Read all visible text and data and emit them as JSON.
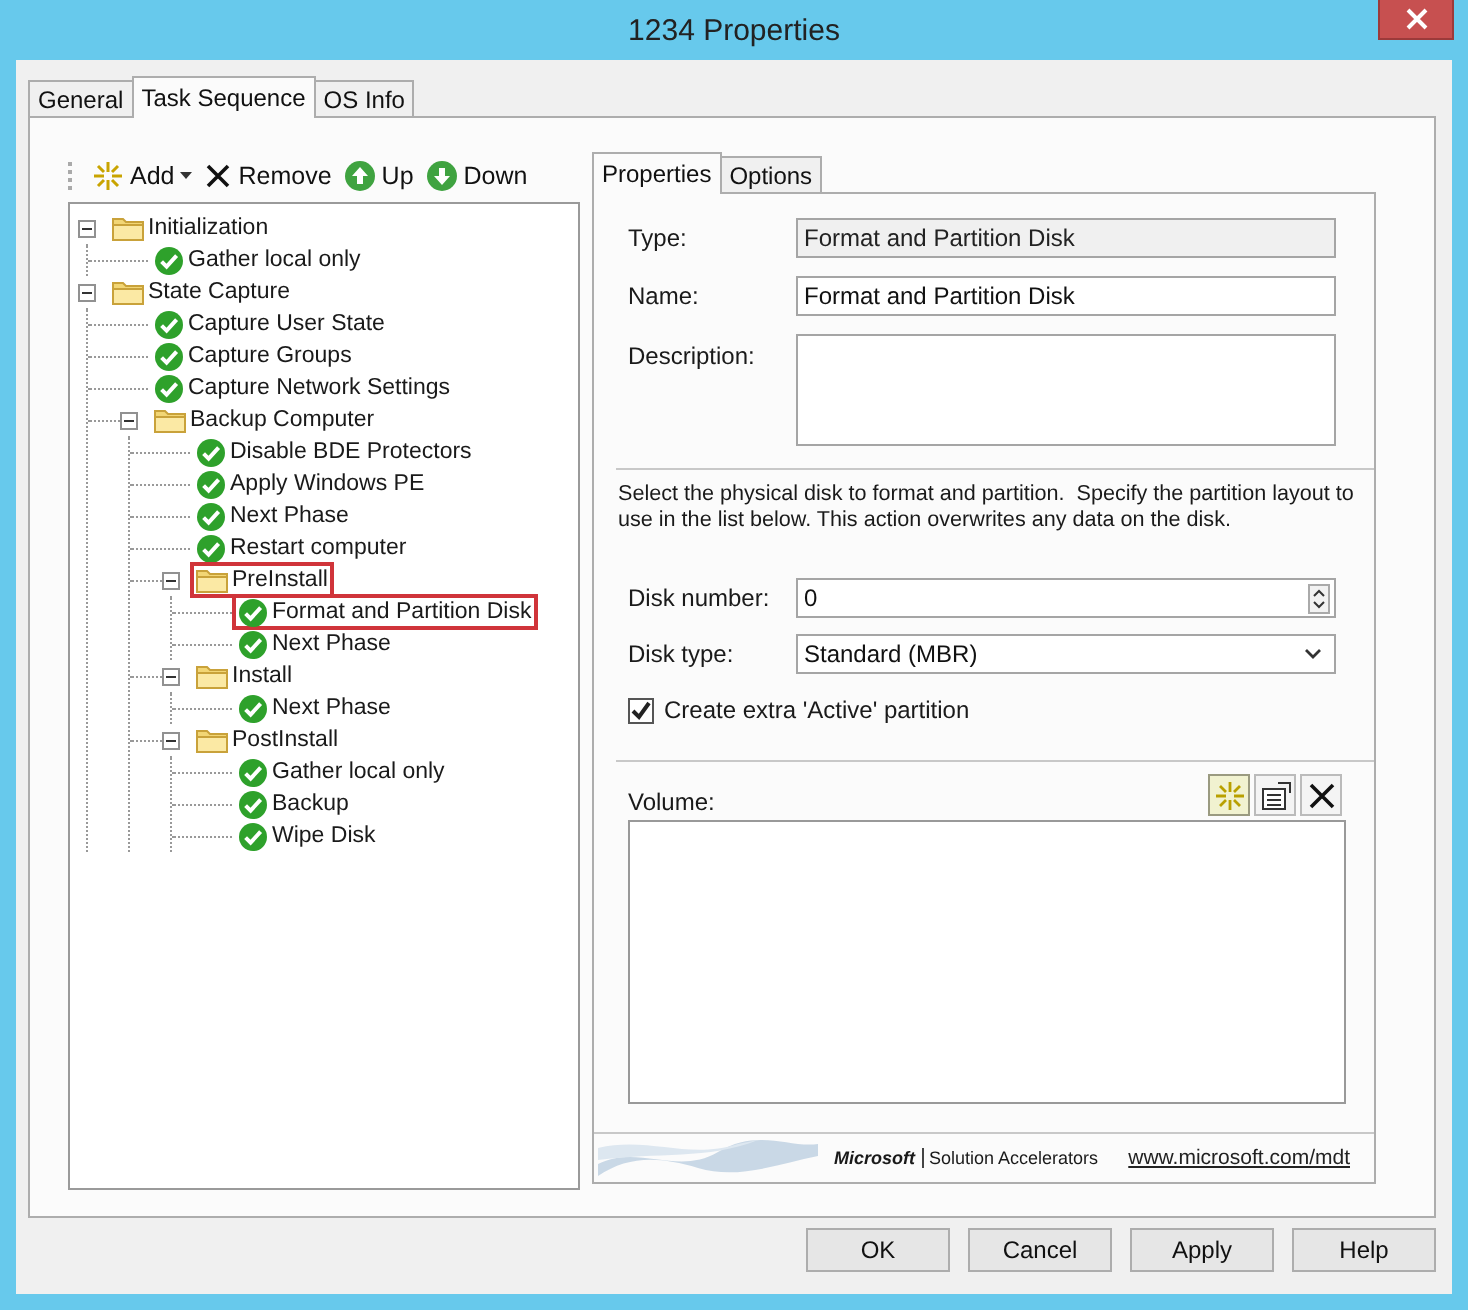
{
  "window": {
    "title": "1234 Properties"
  },
  "tabs": [
    {
      "label": "General",
      "selected": false
    },
    {
      "label": "Task Sequence",
      "selected": true
    },
    {
      "label": "OS Info",
      "selected": false
    }
  ],
  "toolbar": [
    {
      "label": "Add",
      "kind": "add",
      "dropdown": true
    },
    {
      "label": "Remove",
      "kind": "remove",
      "dropdown": false
    },
    {
      "label": "Up",
      "kind": "up",
      "dropdown": false
    },
    {
      "label": "Down",
      "kind": "down",
      "dropdown": false
    }
  ],
  "tree": [
    {
      "label": "Initialization",
      "kind": "group",
      "expanded": true,
      "highlighted": false,
      "children": [
        {
          "label": "Gather local only",
          "kind": "step",
          "highlighted": false
        }
      ]
    },
    {
      "label": "State Capture",
      "kind": "group",
      "expanded": true,
      "highlighted": false,
      "children": [
        {
          "label": "Capture User State",
          "kind": "step",
          "highlighted": false
        },
        {
          "label": "Capture Groups",
          "kind": "step",
          "highlighted": false
        },
        {
          "label": "Capture Network Settings",
          "kind": "step",
          "highlighted": false
        },
        {
          "label": "Backup Computer",
          "kind": "group",
          "expanded": true,
          "highlighted": false,
          "children": [
            {
              "label": "Disable BDE Protectors",
              "kind": "step",
              "highlighted": false
            },
            {
              "label": "Apply Windows PE",
              "kind": "step",
              "highlighted": false
            },
            {
              "label": "Next Phase",
              "kind": "step",
              "highlighted": false
            },
            {
              "label": "Restart computer",
              "kind": "step",
              "highlighted": false
            },
            {
              "label": "PreInstall",
              "kind": "group",
              "expanded": true,
              "highlighted": true,
              "children": [
                {
                  "label": "Format and Partition Disk",
                  "kind": "step",
                  "highlighted": true
                },
                {
                  "label": "Next Phase",
                  "kind": "step",
                  "highlighted": false
                }
              ]
            },
            {
              "label": "Install",
              "kind": "group",
              "expanded": true,
              "highlighted": false,
              "children": [
                {
                  "label": "Next Phase",
                  "kind": "step",
                  "highlighted": false
                }
              ]
            },
            {
              "label": "PostInstall",
              "kind": "group",
              "expanded": true,
              "highlighted": false,
              "children": [
                {
                  "label": "Gather local only",
                  "kind": "step",
                  "highlighted": false
                },
                {
                  "label": "Backup",
                  "kind": "step",
                  "highlighted": false
                },
                {
                  "label": "Wipe Disk",
                  "kind": "step",
                  "highlighted": false
                }
              ]
            }
          ]
        }
      ]
    }
  ],
  "detail_tabs": [
    {
      "label": "Properties",
      "selected": true
    },
    {
      "label": "Options",
      "selected": false
    }
  ],
  "type": {
    "label": "Type:",
    "value": "Format and Partition Disk",
    "disabled": true
  },
  "name": {
    "label": "Name:",
    "value": "Format and Partition Disk",
    "disabled": false
  },
  "description": {
    "label": "Description:"
  },
  "instructions": "Select the physical disk to format and partition.  Specify the partition layout to use in the list below. This action overwrites any data on the disk.",
  "disk_number": {
    "label": "Disk number:",
    "value": "0"
  },
  "disk_type": {
    "label": "Disk type:",
    "value": "Standard (MBR)"
  },
  "active_partition": {
    "label": "Create extra 'Active' partition",
    "checked": true
  },
  "volume": {
    "label": "Volume:",
    "tools": [
      {
        "kind": "new",
        "pressed": true
      },
      {
        "kind": "properties",
        "pressed": false
      },
      {
        "kind": "delete",
        "pressed": false
      }
    ]
  },
  "footer": {
    "brand": "Microsoft",
    "product": "Solution Accelerators",
    "link": "www.microsoft.com/mdt"
  },
  "buttons": [
    "OK",
    "Cancel",
    "Apply",
    "Help"
  ]
}
